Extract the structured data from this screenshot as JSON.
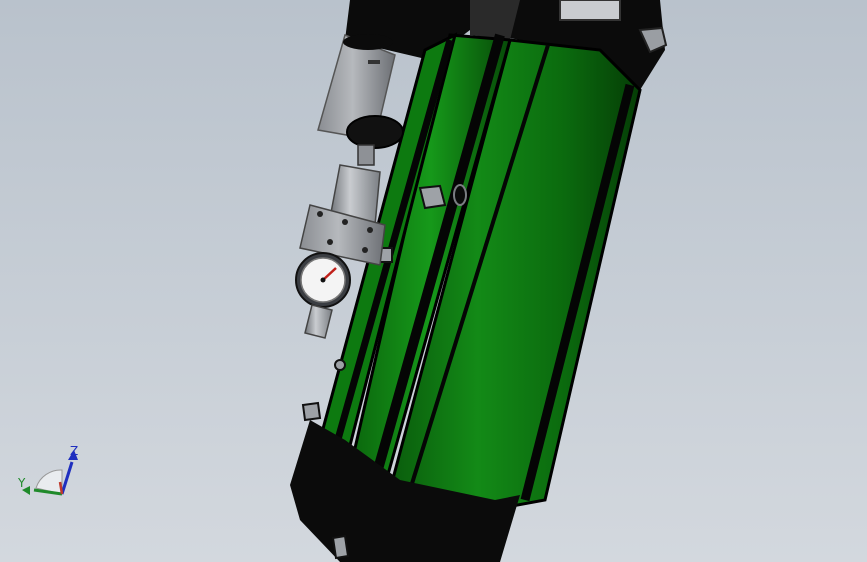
{
  "viewport": {
    "background_top": "#b9c2cc",
    "background_bottom": "#d3d8de"
  },
  "model": {
    "cylinder_color": "#0f7a12",
    "cap_color": "#0b0b0b",
    "metal_color": "#8e9196"
  },
  "gauge": {
    "icon": "pressure-gauge-icon"
  },
  "triad": {
    "y_label": "Y",
    "z_label": "Z",
    "x_color": "#c0392b",
    "y_color": "#1f8a2a",
    "z_color": "#1f2fbf"
  }
}
